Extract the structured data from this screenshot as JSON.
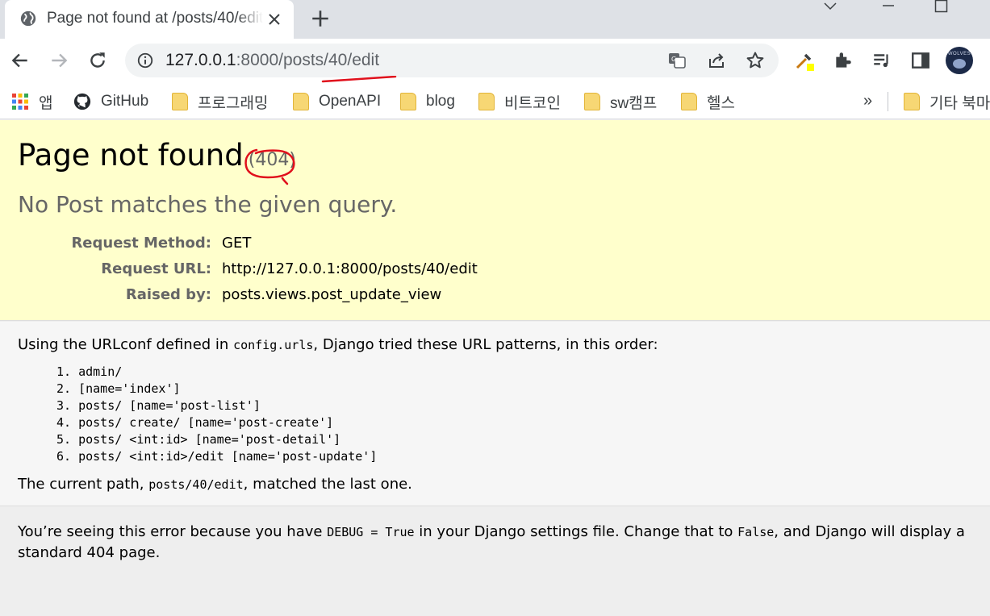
{
  "browser": {
    "tab_title": "Page not found at /posts/40/edit",
    "url_host": "127.0.0.1",
    "url_path": ":8000/posts/40/edit",
    "bookmarks": [
      {
        "label": "앱",
        "icon": "apps-grid-icon"
      },
      {
        "label": "GitHub",
        "icon": "github-icon"
      },
      {
        "label": "프로그래밍",
        "icon": "folder-icon"
      },
      {
        "label": "OpenAPI",
        "icon": "folder-icon"
      },
      {
        "label": "blog",
        "icon": "folder-icon"
      },
      {
        "label": "비트코인",
        "icon": "folder-icon"
      },
      {
        "label": "sw캠프",
        "icon": "folder-icon"
      },
      {
        "label": "헬스",
        "icon": "folder-icon"
      }
    ],
    "bookmarks_overflow": "»",
    "other_bookmarks": "기타 북마크",
    "avatar_text": "WOLVES"
  },
  "error": {
    "title": "Page not found",
    "code": "(404)",
    "message": "No Post matches the given query.",
    "request": [
      {
        "label": "Request Method:",
        "value": "GET"
      },
      {
        "label": "Request URL:",
        "value": "http://127.0.0.1:8000/posts/40/edit"
      },
      {
        "label": "Raised by:",
        "value": "posts.views.post_update_view"
      }
    ]
  },
  "info": {
    "intro_before": "Using the URLconf defined in ",
    "urlconf": "config.urls",
    "intro_after": ", Django tried these URL patterns, in this order:",
    "patterns": [
      "1. admin/",
      "2. [name='index']",
      "3. posts/ [name='post-list']",
      "4. posts/ create/ [name='post-create']",
      "5. posts/ <int:id> [name='post-detail']",
      "6. posts/ <int:id>/edit [name='post-update']"
    ],
    "current_before": "The current path, ",
    "current_path": "posts/40/edit",
    "current_after": ", matched the last one."
  },
  "explanation": {
    "t1": "You’re seeing this error because you have ",
    "debug_code": "DEBUG = True",
    "t2": " in your Django settings file. Change that to ",
    "false_code": "False",
    "t3": ", and Django will display a standard 404 page."
  },
  "colors": {
    "summary_bg": "#ffffcc",
    "info_bg": "#f6f6f6",
    "explanation_bg": "#eeeeee",
    "annotation_red": "#e0101c"
  }
}
